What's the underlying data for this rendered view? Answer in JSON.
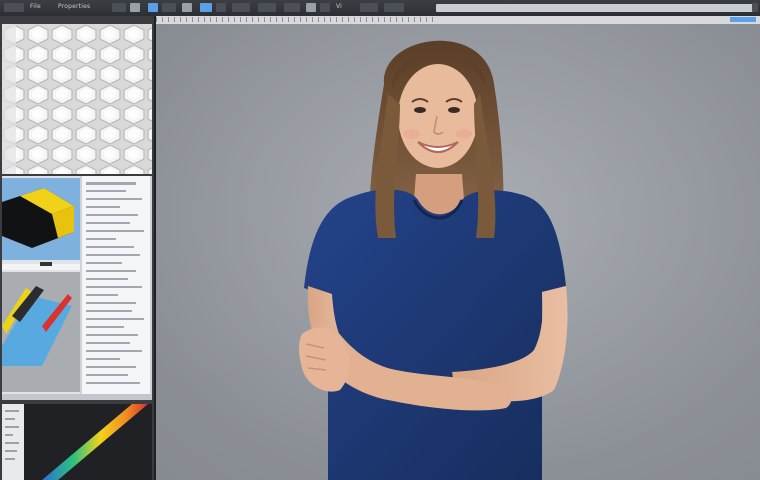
{
  "toolbar": {
    "tab_labels": [
      "File",
      "Properties",
      "Vi"
    ]
  },
  "panels": {
    "thumbnail_count": 3
  },
  "colors": {
    "canvas_bg": "#959aa0",
    "toolbar_bg": "#33363a",
    "accent": "#5aa0e6",
    "shirt": "#1f3a72",
    "hair": "#6b4a30",
    "skin": "#e3b597"
  }
}
